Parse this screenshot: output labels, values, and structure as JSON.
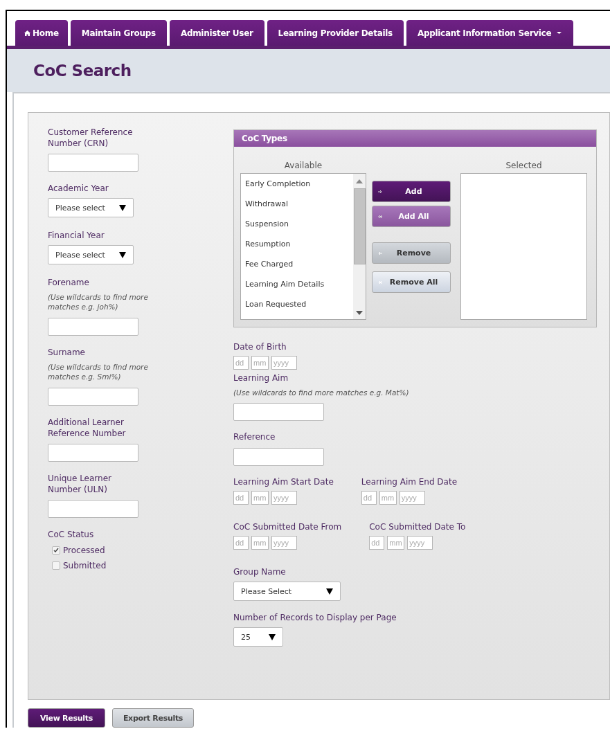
{
  "tabs": [
    {
      "label": "Home",
      "kind": "home",
      "selected": false
    },
    {
      "label": "Maintain Groups",
      "kind": "plain",
      "selected": false
    },
    {
      "label": "Administer User",
      "kind": "plain",
      "selected": false
    },
    {
      "label": "Learning Provider Details",
      "kind": "plain",
      "selected": false
    },
    {
      "label": "Applicant Information Service",
      "kind": "menu",
      "selected": false
    }
  ],
  "page_title": "CoC Search",
  "left_fields": [
    {
      "kind": "text",
      "label": "Customer Reference Number (CRN)"
    },
    {
      "kind": "select",
      "label": "Academic Year",
      "value": "Please select"
    },
    {
      "kind": "select",
      "label": "Financial Year",
      "value": "Please select"
    },
    {
      "kind": "text",
      "label": "Forename",
      "hint": "(Use wildcards to find more matches e.g. joh%)"
    },
    {
      "kind": "text",
      "label": "Surname",
      "hint": "(Use wildcards to find more matches e.g. Smi%)"
    },
    {
      "kind": "text",
      "label": "Additional Learner Reference Number"
    },
    {
      "kind": "text",
      "label": "Unique Learner Number (ULN)"
    },
    {
      "kind": "checks",
      "label": "CoC Status",
      "options": [
        {
          "label": "Processed",
          "checked": true
        },
        {
          "label": "Submitted",
          "checked": false
        }
      ]
    }
  ],
  "coc_types": {
    "title": "CoC Types",
    "available_label": "Available",
    "selected_label": "Selected",
    "available": [
      "Early Completion",
      "Withdrawal",
      "Suspension",
      "Resumption",
      "Fee Charged",
      "Learning Aim Details",
      "Loan Requested"
    ],
    "buttons": [
      {
        "label": "Add",
        "kind": "primary"
      },
      {
        "label": "Add All",
        "kind": "secondary"
      },
      {
        "label": "Remove",
        "kind": "neutral"
      },
      {
        "label": "Remove All",
        "kind": "light"
      }
    ]
  },
  "right_fields": [
    {
      "kind": "date",
      "label": "Date of Birth",
      "placeholders": [
        "dd",
        "mm",
        "yyyy"
      ]
    },
    {
      "kind": "text",
      "label": "Learning Aim",
      "hint": "(Use wildcards to find more matches e.g. Mat%)"
    },
    {
      "kind": "text",
      "label": "Reference"
    },
    {
      "kind": "date_pair",
      "items": [
        {
          "label": "Learning Aim Start Date",
          "placeholders": [
            "dd",
            "mm",
            "yyyy"
          ]
        },
        {
          "label": "Learning Aim End Date",
          "placeholders": [
            "dd",
            "mm",
            "yyyy"
          ]
        }
      ]
    },
    {
      "kind": "date_pair",
      "items": [
        {
          "label": "CoC Submitted Date From",
          "placeholders": [
            "dd",
            "mm",
            "yyyy"
          ]
        },
        {
          "label": "CoC Submitted Date To",
          "placeholders": [
            "dd",
            "mm",
            "yyyy"
          ]
        }
      ]
    },
    {
      "kind": "select",
      "label": "Group Name",
      "value": "Please Select"
    },
    {
      "kind": "select",
      "label": "Number of Records to Display per Page",
      "value": "25"
    }
  ],
  "actions": [
    {
      "label": "View Results",
      "kind": "primary"
    },
    {
      "label": "Export Results",
      "kind": "secondary"
    }
  ]
}
